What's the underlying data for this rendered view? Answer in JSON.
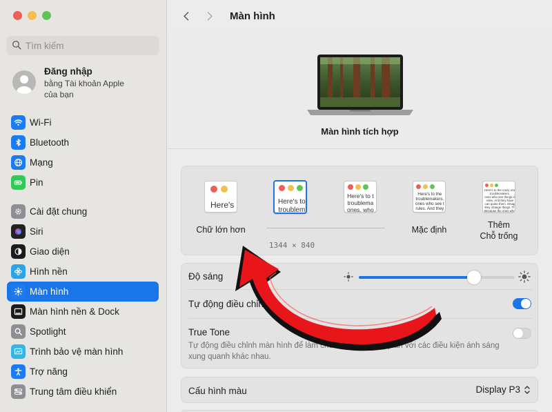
{
  "window_controls": [
    "close",
    "minimize",
    "zoom"
  ],
  "sidebar": {
    "search_placeholder": "Tìm kiếm",
    "account": {
      "name": "Đăng nhập",
      "subtitle": "bằng Tài khoản Apple của bạn"
    },
    "group1": [
      {
        "label": "Wi-Fi",
        "icon": "wifi-icon",
        "color": "#1a7cf0"
      },
      {
        "label": "Bluetooth",
        "icon": "bluetooth-icon",
        "color": "#1a7cf0"
      },
      {
        "label": "Mạng",
        "icon": "globe-icon",
        "color": "#1a7cf0"
      },
      {
        "label": "Pin",
        "icon": "battery-icon",
        "color": "#34c759"
      }
    ],
    "group2": [
      {
        "label": "Cài đặt chung",
        "icon": "gear-icon",
        "color": "#8e8e93"
      },
      {
        "label": "Siri",
        "icon": "siri-icon",
        "color": "#222222"
      },
      {
        "label": "Giao diện",
        "icon": "appearance-icon",
        "color": "#1c1c1e"
      },
      {
        "label": "Hình nền",
        "icon": "wallpaper-icon",
        "color": "#2aa3e8"
      },
      {
        "label": "Màn hình",
        "icon": "display-icon",
        "color": "#1a7cf0",
        "active": true
      },
      {
        "label": "Màn hình nền & Dock",
        "icon": "dock-icon",
        "color": "#1c1c1e"
      },
      {
        "label": "Spotlight",
        "icon": "spotlight-icon",
        "color": "#8e8e93"
      },
      {
        "label": "Trình bảo vệ màn hình",
        "icon": "screensaver-icon",
        "color": "#35b5e5"
      },
      {
        "label": "Trợ năng",
        "icon": "accessibility-icon",
        "color": "#1a7cf0"
      },
      {
        "label": "Trung tâm điều khiển",
        "icon": "control-center-icon",
        "color": "#8e8e93"
      }
    ]
  },
  "main": {
    "title": "Màn hình",
    "display_name": "Màn hình tích hợp",
    "resolution": {
      "options": [
        {
          "label": "Chữ lớn hơn",
          "preview": "Here's"
        },
        {
          "label": "",
          "preview": "Here's to\ntroublem",
          "selected": true
        },
        {
          "label": "",
          "preview": "Here's to t\ntroublema\nones, who"
        },
        {
          "label": "Mặc định",
          "preview": "Here's to the\ntroublemakers.\nones who see t\nrules. And they"
        },
        {
          "label": "Thêm\nChỗ trống",
          "preview": "Here's to the crazy one\ntroublemakers.\nones who see things di\nrules. And they have\ncan quote them. Disag\nthey change things. Th\nBecause the ones who"
        }
      ],
      "current_resolution": "1344 × 840"
    },
    "brightness": {
      "label": "Độ sáng",
      "value": 0.74
    },
    "auto_brightness": {
      "label": "Tự động điều chỉnh",
      "enabled": true
    },
    "true_tone": {
      "label": "True Tone",
      "description": "Tự động điều chỉnh màn hình để làm cho màu sắc nhất quán với các điều kiện ánh sáng xung quanh khác nhau.",
      "enabled": false
    },
    "color_profile": {
      "label": "Cấu hình màu",
      "value": "Display P3"
    }
  },
  "accent_color": "#1a75e8",
  "annotation": "red-arrow"
}
